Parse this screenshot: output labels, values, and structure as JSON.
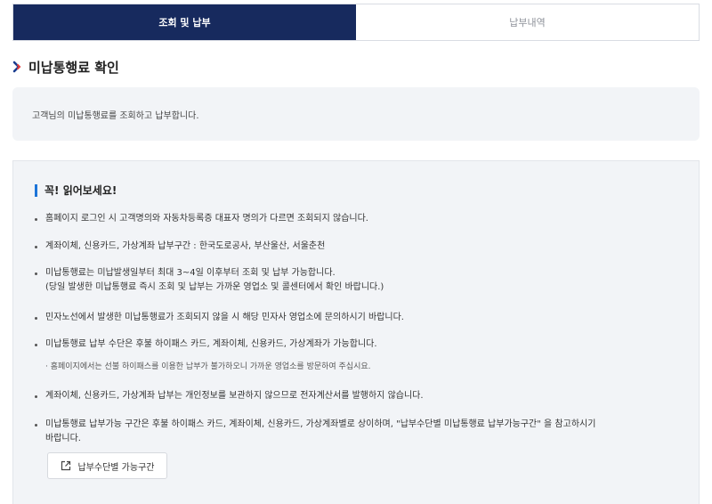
{
  "tabs": [
    {
      "label": "조회 및 납부",
      "active": true
    },
    {
      "label": "납부내역",
      "active": false
    }
  ],
  "section": {
    "title": "미납통행료 확인"
  },
  "info": {
    "text": "고객님의 미납통행료를 조회하고 납부합니다."
  },
  "notice": {
    "title": "꼭! 읽어보세요!",
    "items": [
      {
        "lines": [
          "홈페이지 로그인 시 고객명의와 자동차등록증 대표자 명의가 다르면 조회되지 않습니다."
        ]
      },
      {
        "lines": [
          "계좌이체, 신용카드, 가상계좌 납부구간 : 한국도로공사, 부산울산, 서울춘천"
        ]
      },
      {
        "lines": [
          "미납통행료는 미납발생일부터 최대 3~4일 이후부터 조회 및 납부 가능합니다.",
          "(당일 발생한 미납통행료 즉시 조회 및 납부는 가까운 영업소 및 콜센터에서 확인 바랍니다.)"
        ]
      },
      {
        "lines": [
          "민자노선에서 발생한 미납통행료가 조회되지 않을 시 해당 민자사 영업소에 문의하시기 바랍니다."
        ]
      },
      {
        "lines": [
          "미납통행료 납부 수단은 후불 하이패스 카드, 계좌이체, 신용카드, 가상계좌가 가능합니다."
        ],
        "sub": "· 홈페이지에서는 선불 하이패스를 이용한 납부가 불가하오니 가까운 영업소를 방문하여 주십시요."
      },
      {
        "lines": [
          "계좌이체, 신용카드, 가상계좌 납부는 개인정보를 보관하지 않으므로 전자계산서를 발행하지 않습니다."
        ]
      },
      {
        "lines": [
          "미납통행료 납부가능 구간은 후불 하이패스 카드, 계좌이체, 신용카드, 가상계좌별로 상이하며, \"납부수단별 미납통행료 납부가능구간\" 을 참고하시기",
          "바랍니다."
        ]
      }
    ],
    "button_label": "납부수단별 가능구간"
  },
  "colors": {
    "tab_active_bg": "#172a5e",
    "accent_bar": "#1d74d8",
    "chevron_blue": "#1a3d8f",
    "chevron_red": "#e03a3a",
    "panel_bg": "#f2f4f7"
  },
  "icons": {
    "section": "chevron-right-icon",
    "button": "external-link-icon"
  }
}
